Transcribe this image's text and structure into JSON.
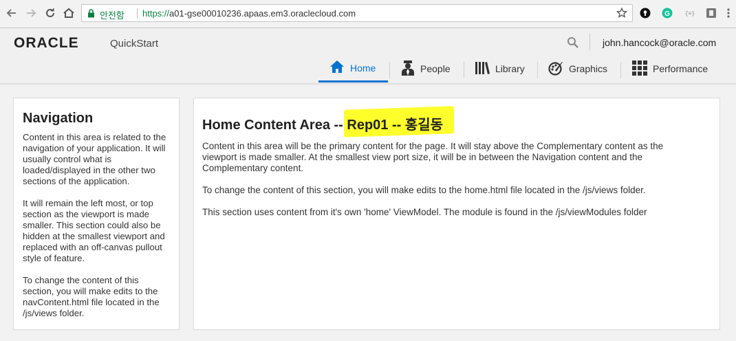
{
  "browser": {
    "secure_label": "안전함",
    "url_scheme": "https://",
    "url_rest": "a01-gse00010236.apaas.em3.oraclecloud.com"
  },
  "header": {
    "logo": "ORACLE",
    "product": "QuickStart",
    "user": "john.hancock@oracle.com"
  },
  "tabs": [
    {
      "label": "Home",
      "icon": "home-icon",
      "active": true
    },
    {
      "label": "People",
      "icon": "person-icon",
      "active": false
    },
    {
      "label": "Library",
      "icon": "library-icon",
      "active": false
    },
    {
      "label": "Graphics",
      "icon": "palette-icon",
      "active": false
    },
    {
      "label": "Performance",
      "icon": "grid-icon",
      "active": false
    }
  ],
  "navigation": {
    "title": "Navigation",
    "paragraphs": [
      "Content in this area is related to the navigation of your application. It will usually control what is loaded/displayed in the other two sections of the application.",
      "It will remain the left most, or top section as the viewport is made smaller. This section could also be hidden at the smallest viewport and replaced with an off-canvas pullout style of feature.",
      "To change the content of this section, you will make edits to the navContent.html file located in the /js/views folder."
    ]
  },
  "main": {
    "title_prefix": "Home Content Area -- ",
    "title_highlight": "Rep01 -- 홍길동",
    "highlight_color": "#ffff2c",
    "paragraphs": [
      "Content in this area will be the primary content for the page. It will stay above the Complementary content as the viewport is made smaller. At the smallest view port size, it will be in between the Navigation content and the Complementary content.",
      "To change the content of this section, you will make edits to the home.html file located in the /js/views folder.",
      "This section uses content from it's own 'home' ViewModel. The module is found in the /js/viewModules folder"
    ]
  },
  "colors": {
    "accent": "#0572ce",
    "secure_green": "#0b8043"
  }
}
